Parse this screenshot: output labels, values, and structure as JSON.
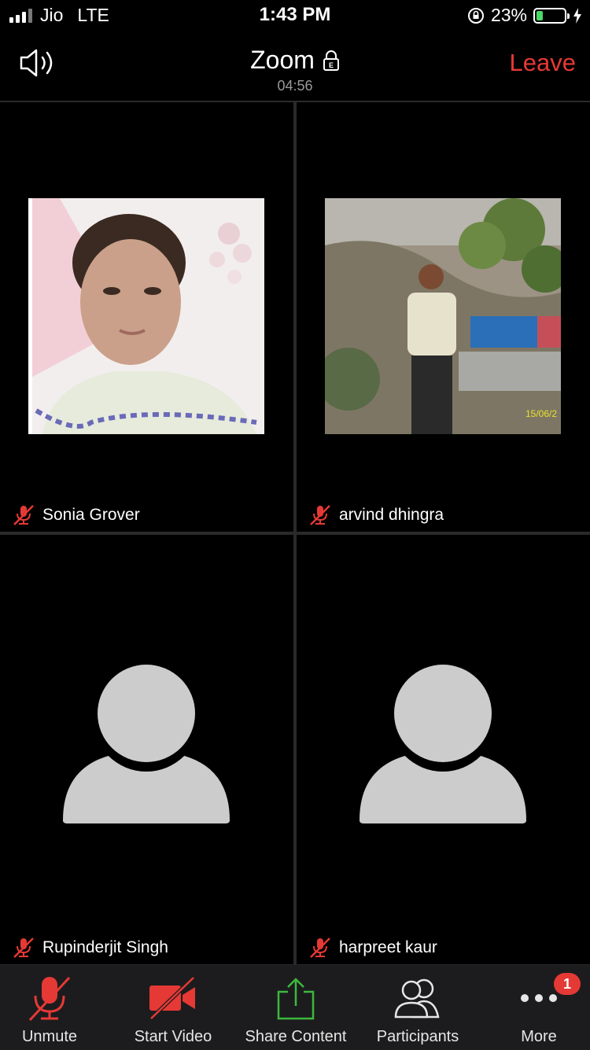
{
  "status_bar": {
    "carrier": "Jio",
    "network": "LTE",
    "time": "1:43 PM",
    "battery_percent": "23%",
    "battery_level": 0.23,
    "battery_color": "#4cd964"
  },
  "header": {
    "title": "Zoom",
    "meeting_timer": "04:56",
    "leave_label": "Leave",
    "leave_color": "#e53935",
    "speaker_icon": "speaker-icon",
    "lock_icon": "encryption-lock-icon"
  },
  "participants": [
    {
      "name": "Sonia Grover",
      "muted": true,
      "video": "photo"
    },
    {
      "name": "arvind dhingra",
      "muted": true,
      "video": "photo"
    },
    {
      "name": "Rupinderjit Singh",
      "muted": true,
      "video": "avatar"
    },
    {
      "name": "harpreet kaur",
      "muted": true,
      "video": "avatar"
    }
  ],
  "toolbar": {
    "unmute_label": "Unmute",
    "start_video_label": "Start Video",
    "share_label": "Share Content",
    "participants_label": "Participants",
    "more_label": "More",
    "more_badge": "1"
  }
}
